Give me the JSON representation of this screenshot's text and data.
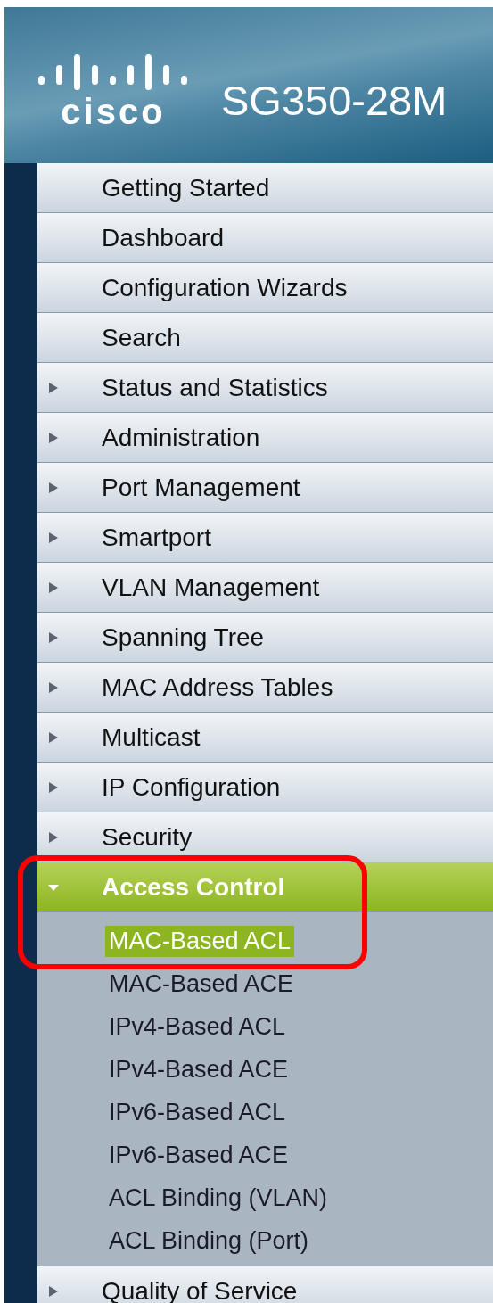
{
  "header": {
    "logo_text": "cisco",
    "title": "SG350-28M"
  },
  "menu": [
    {
      "label": "Getting Started",
      "kind": "page"
    },
    {
      "label": "Dashboard",
      "kind": "page"
    },
    {
      "label": "Configuration Wizards",
      "kind": "page"
    },
    {
      "label": "Search",
      "kind": "page"
    },
    {
      "label": "Status and Statistics",
      "kind": "folder",
      "expanded": false
    },
    {
      "label": "Administration",
      "kind": "folder",
      "expanded": false
    },
    {
      "label": "Port Management",
      "kind": "folder",
      "expanded": false
    },
    {
      "label": "Smartport",
      "kind": "folder",
      "expanded": false
    },
    {
      "label": "VLAN Management",
      "kind": "folder",
      "expanded": false
    },
    {
      "label": "Spanning Tree",
      "kind": "folder",
      "expanded": false
    },
    {
      "label": "MAC Address Tables",
      "kind": "folder",
      "expanded": false
    },
    {
      "label": "Multicast",
      "kind": "folder",
      "expanded": false
    },
    {
      "label": "IP Configuration",
      "kind": "folder",
      "expanded": false
    },
    {
      "label": "Security",
      "kind": "folder",
      "expanded": false
    },
    {
      "label": "Access Control",
      "kind": "folder",
      "expanded": true,
      "highlighted": true,
      "children": [
        {
          "label": "MAC-Based ACL",
          "selected": true
        },
        {
          "label": "MAC-Based ACE",
          "selected": false
        },
        {
          "label": "IPv4-Based ACL",
          "selected": false
        },
        {
          "label": "IPv4-Based ACE",
          "selected": false
        },
        {
          "label": "IPv6-Based ACL",
          "selected": false
        },
        {
          "label": "IPv6-Based ACE",
          "selected": false
        },
        {
          "label": "ACL Binding (VLAN)",
          "selected": false
        },
        {
          "label": "ACL Binding (Port)",
          "selected": false
        }
      ]
    },
    {
      "label": "Quality of Service",
      "kind": "folder",
      "expanded": false
    }
  ]
}
